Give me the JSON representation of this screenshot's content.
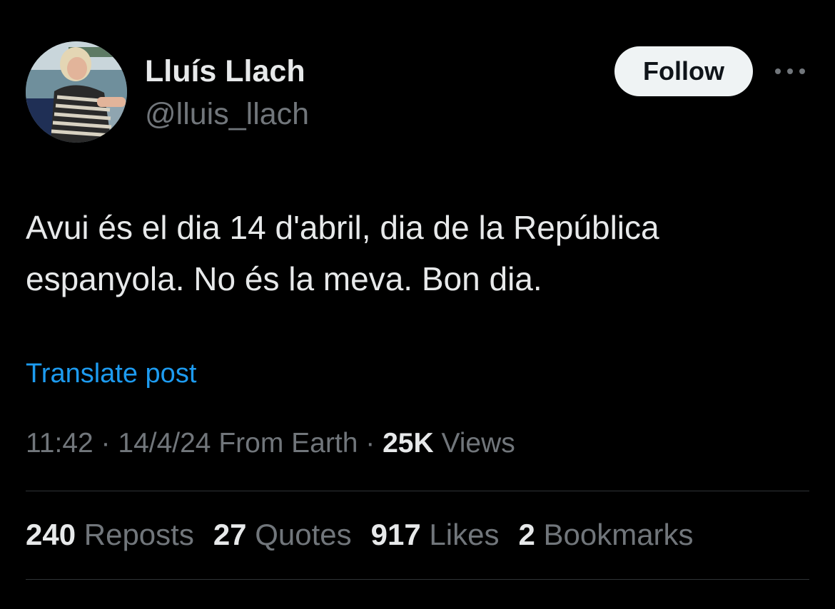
{
  "author": {
    "display_name": "Lluís Llach",
    "handle": "@lluis_llach"
  },
  "follow_label": "Follow",
  "more_icon": "more-dots-icon",
  "tweet": {
    "text_line1": "Avui és el dia 14 d'abril, dia de la República",
    "text_line2": "espanyola. No és la meva. Bon dia."
  },
  "translate_label": "Translate post",
  "meta": {
    "time": "11:42",
    "separator": " · ",
    "date": "14/4/24",
    "location": "From Earth",
    "views_count": "25K",
    "views_label": "Views"
  },
  "stats": [
    {
      "count": "240",
      "label": "Reposts"
    },
    {
      "count": "27",
      "label": "Quotes"
    },
    {
      "count": "917",
      "label": "Likes"
    },
    {
      "count": "2",
      "label": "Bookmarks"
    }
  ],
  "colors": {
    "background": "#000000",
    "text_primary": "#e7e9ea",
    "text_secondary": "#71767b",
    "link": "#1d9bf0",
    "button_bg": "#eff3f4",
    "divider": "#2f3336"
  }
}
